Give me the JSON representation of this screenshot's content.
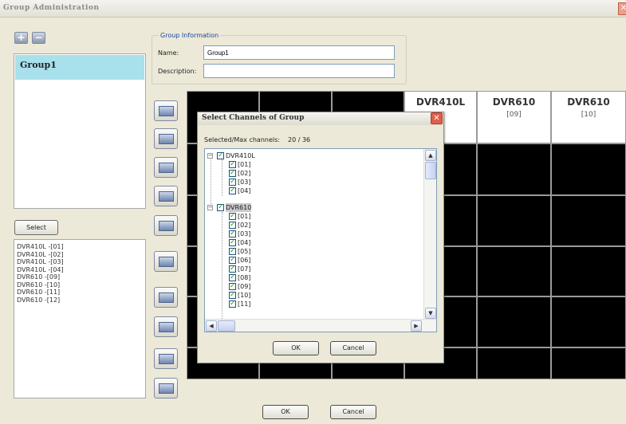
{
  "window": {
    "title": "Group Administration",
    "close_icon": "close-icon"
  },
  "toolbar": {
    "add_icon": "add-group-icon",
    "remove_icon": "remove-group-icon"
  },
  "groups": [
    {
      "label": "Group1"
    }
  ],
  "select_button": "Select",
  "selected_channels": [
    "DVR410L -[01]",
    "DVR410L -[02]",
    "DVR410L -[03]",
    "DVR410L -[04]",
    "DVR610 -[09]",
    "DVR610 -[10]",
    "DVR610 -[11]",
    "DVR610 -[12]"
  ],
  "group_info": {
    "legend": "Group Information",
    "name_label": "Name:",
    "name_value": "Group1",
    "description_label": "Description:",
    "description_value": ""
  },
  "grid_headers": [
    {
      "name": "DVR410L",
      "channel": ""
    },
    {
      "name": "DVR610",
      "channel": "[09]"
    },
    {
      "name": "DVR610",
      "channel": "[10]"
    }
  ],
  "main_buttons": {
    "ok": "OK",
    "cancel": "Cancel"
  },
  "dialog": {
    "title": "Select Channels of Group",
    "info_label": "Selected/Max channels:",
    "count": "20 / 36",
    "tree": [
      {
        "label": "DVR410L",
        "level": 0,
        "expander": "−"
      },
      {
        "label": "[01]",
        "level": 1
      },
      {
        "label": "[02]",
        "level": 1
      },
      {
        "label": "[03]",
        "level": 1
      },
      {
        "label": "[04]",
        "level": 1
      },
      {
        "label": "DVR610",
        "level": 0,
        "expander": "−"
      },
      {
        "label": "[01]",
        "level": 1
      },
      {
        "label": "[02]",
        "level": 1
      },
      {
        "label": "[03]",
        "level": 1
      },
      {
        "label": "[04]",
        "level": 1
      },
      {
        "label": "[05]",
        "level": 1
      },
      {
        "label": "[06]",
        "level": 1
      },
      {
        "label": "[07]",
        "level": 1
      },
      {
        "label": "[08]",
        "level": 1
      },
      {
        "label": "[09]",
        "level": 1
      },
      {
        "label": "[10]",
        "level": 1
      },
      {
        "label": "[11]",
        "level": 1
      }
    ],
    "ok": "OK",
    "cancel": "Cancel"
  },
  "colors": {
    "selected_group": "#a8e0ec",
    "legend_text": "#1a44a6",
    "check": "#21a121",
    "dialog_close": "#e05f4a"
  }
}
